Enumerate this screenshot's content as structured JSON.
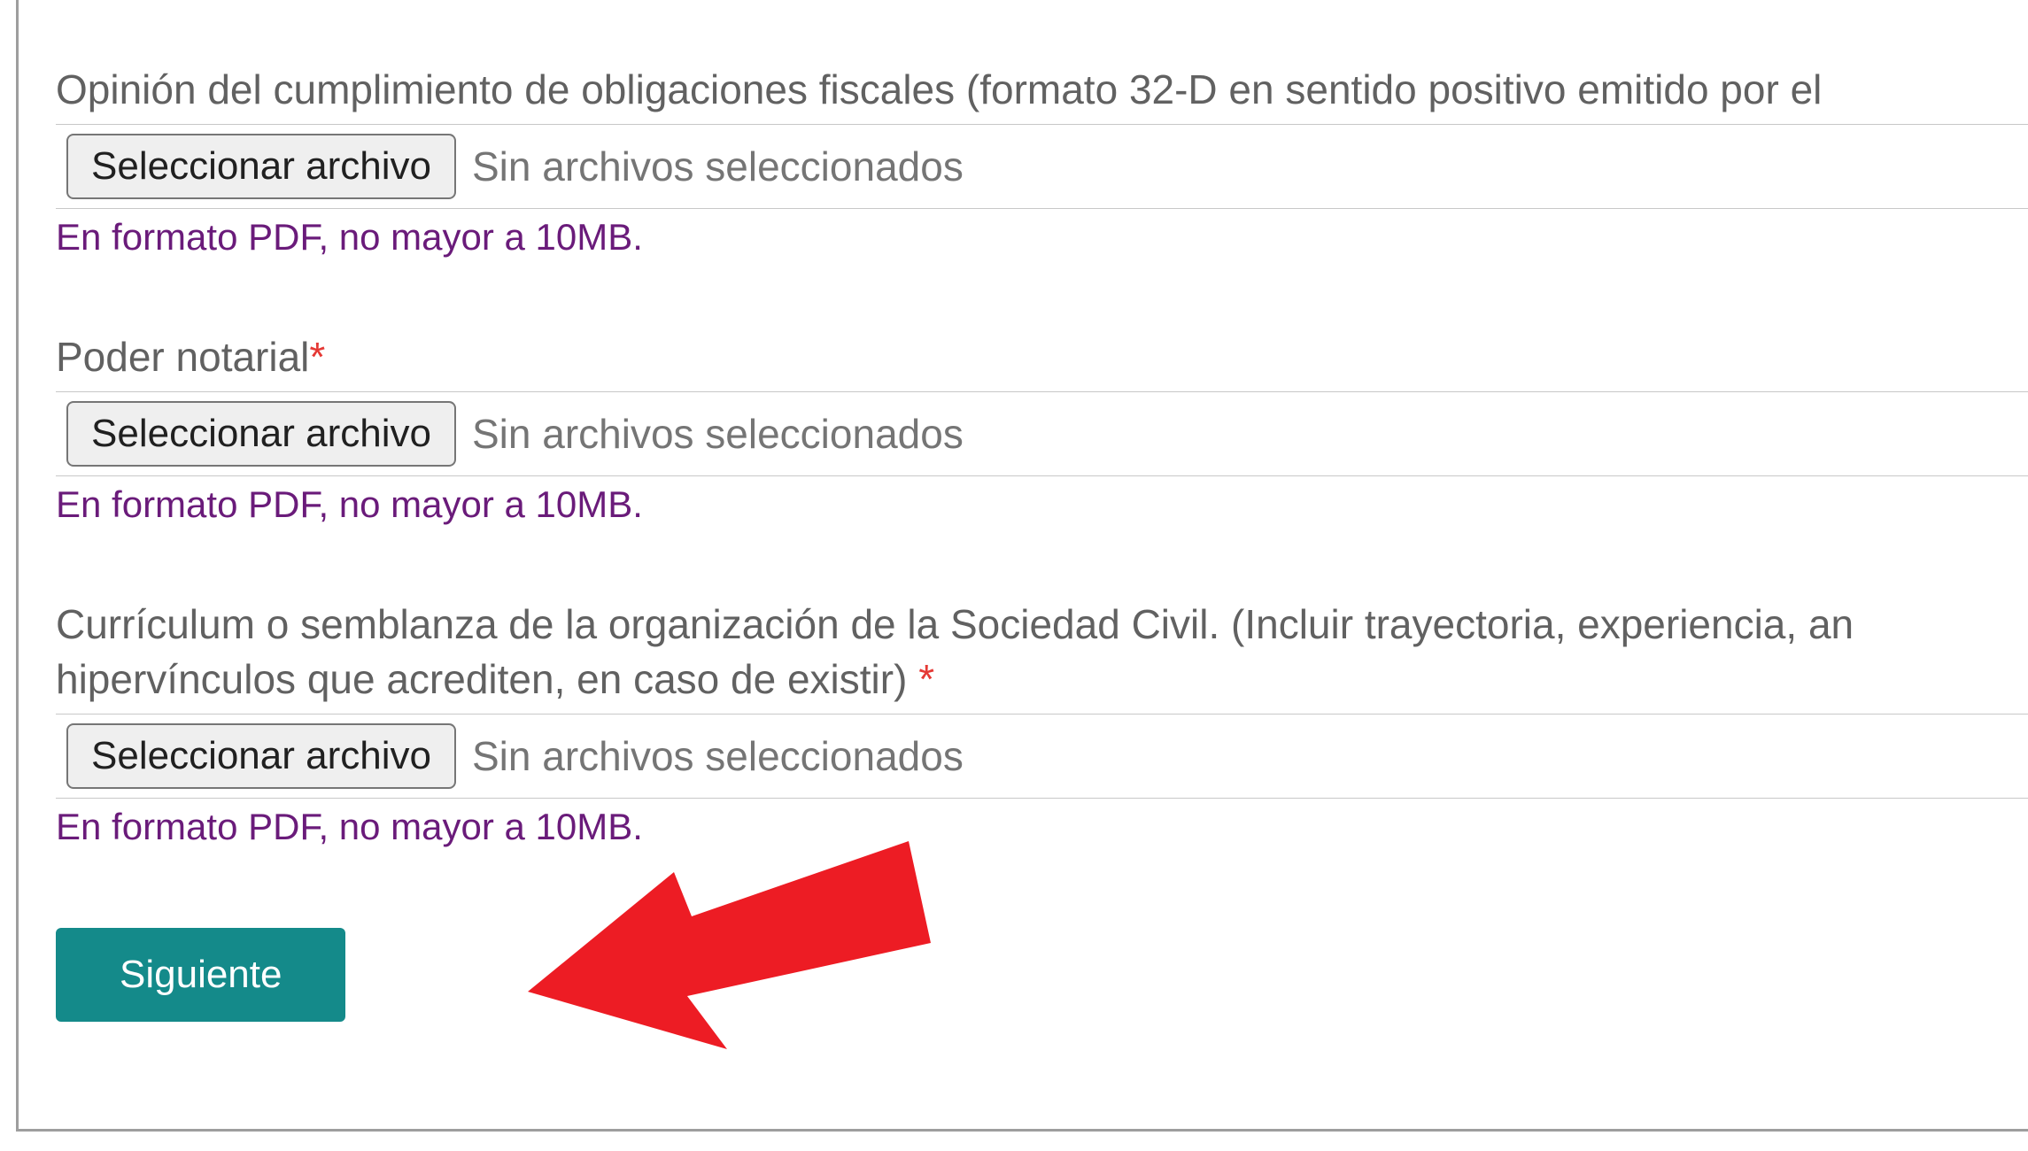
{
  "fields": {
    "fiscal": {
      "label": "Opinión del cumplimiento de obligaciones fiscales (formato 32-D en sentido positivo emitido por el",
      "button_label": "Seleccionar archivo",
      "status": "Sin archivos seleccionados",
      "hint": "En formato PDF, no mayor a 10MB."
    },
    "notarial": {
      "label": "Poder notarial",
      "required_marker": "*",
      "button_label": "Seleccionar archivo",
      "status": "Sin archivos seleccionados",
      "hint": "En formato PDF, no mayor a 10MB."
    },
    "curriculum": {
      "label_line1": "Currículum o semblanza de la organización de la Sociedad Civil. (Incluir trayectoria, experiencia, an",
      "label_line2_prefix": "hipervínculos que acrediten, en caso de existir) ",
      "required_marker": "*",
      "button_label": "Seleccionar archivo",
      "status": "Sin archivos seleccionados",
      "hint": "En formato PDF, no mayor a 10MB."
    }
  },
  "actions": {
    "next_label": "Siguiente"
  }
}
